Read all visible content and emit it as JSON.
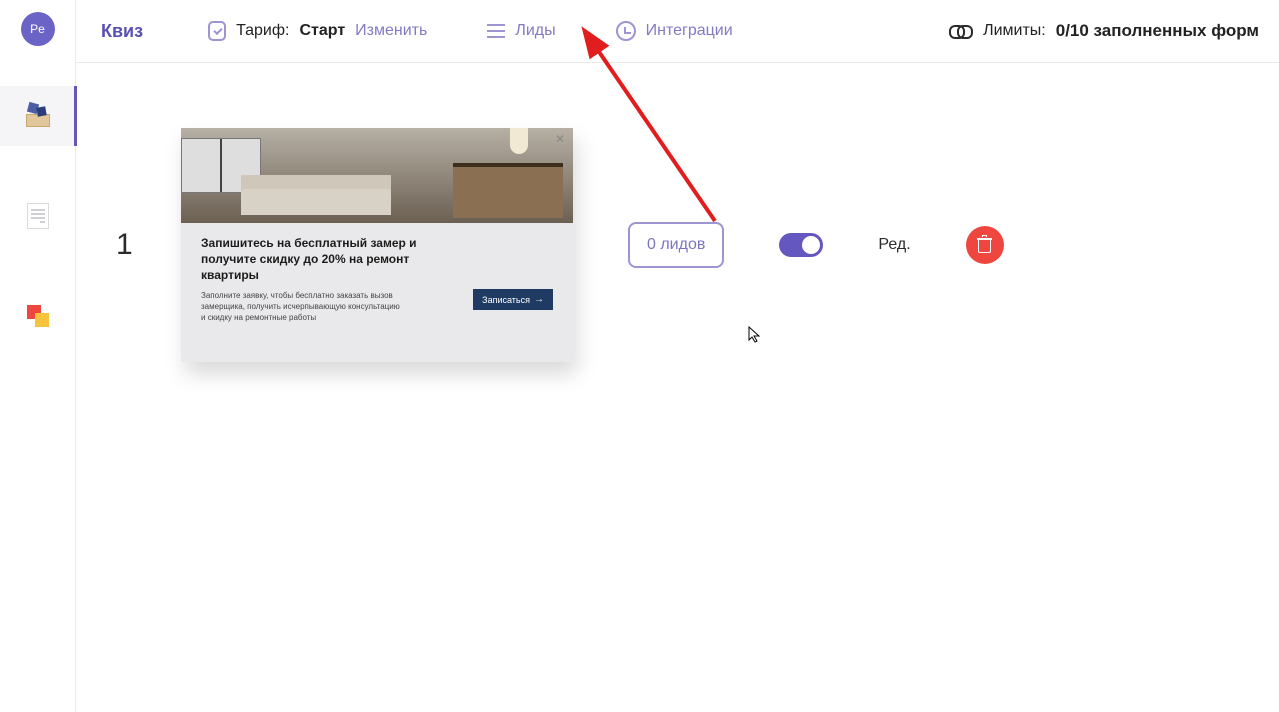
{
  "sidebar": {
    "avatar_label": "Pe"
  },
  "topbar": {
    "brand": "Квиз",
    "tariff_label": "Тариф:",
    "tariff_name": "Старт",
    "change_link": "Изменить",
    "leads_link": "Лиды",
    "integrations_link": "Интеграции",
    "limits_label": "Лимиты:",
    "limits_value": "0/10 заполненных форм"
  },
  "quiz": {
    "index": "1",
    "card": {
      "title": "Запишитесь на бесплатный замер и получите скидку до 20% на ремонт квартиры",
      "desc": "Заполните заявку, чтобы бесплатно заказать вызов замерщика, получить исчерпывающую консультацию и скидку на ремонтные работы",
      "cta": "Записаться",
      "close": "✕"
    },
    "leads_btn": "0 лидов",
    "edit_link": "Ред."
  },
  "annotation": {
    "arrow_color": "#e11d1d"
  }
}
